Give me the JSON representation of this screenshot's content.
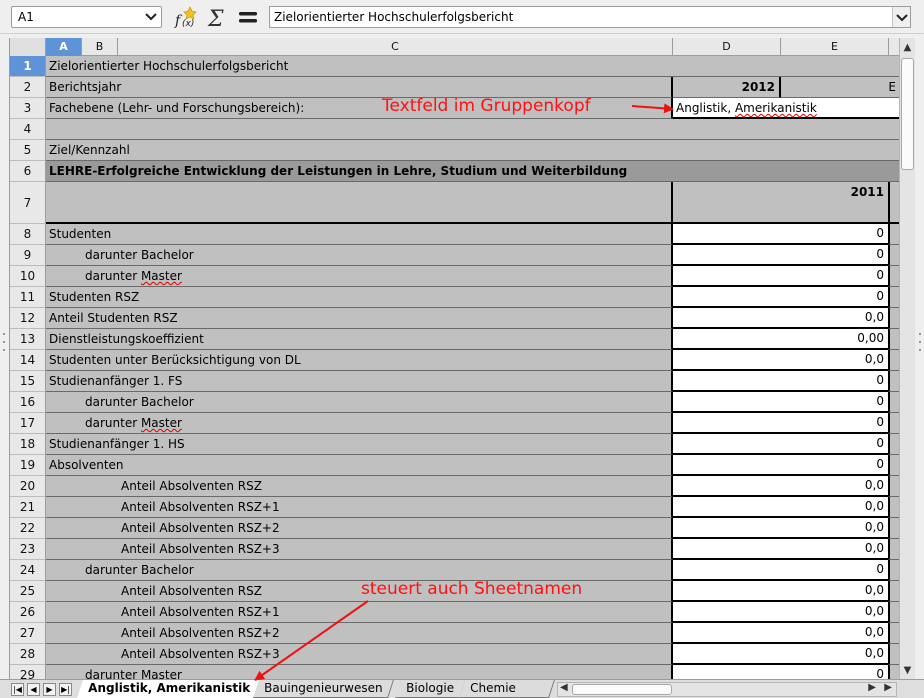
{
  "formula_bar": {
    "name_box": "A1",
    "function_wizard_icon": "function-wizard-icon",
    "sum_icon": "sum-icon",
    "equals_icon": "equals-icon",
    "formula": "Zielorientierter Hochschulerfolgsbericht"
  },
  "columns": [
    {
      "label": "A",
      "selected": true
    },
    {
      "label": "B",
      "selected": false
    },
    {
      "label": "C",
      "selected": false
    },
    {
      "label": "D",
      "selected": false
    },
    {
      "label": "E",
      "selected": false
    }
  ],
  "header": {
    "r1": "Zielorientierter Hochschulerfolgsbericht",
    "r2_label": "Berichtsjahr",
    "r2_value": "2012",
    "r2_e": "E",
    "r3_label": "Fachebene (Lehr- und Forschungsbereich):",
    "r3_value_a": "Anglistik, ",
    "r3_value_b": "Amerikanistik",
    "r5": "Ziel/Kennzahl",
    "r6": "LEHRE-Erfolgreiche Entwicklung der Leistungen in Lehre, Studium und Weiterbildung",
    "r7_value": "2011"
  },
  "row_numbers": [
    "1",
    "2",
    "3",
    "4",
    "5",
    "6",
    "7",
    "8",
    "9",
    "10",
    "11",
    "12",
    "13",
    "14",
    "15",
    "16",
    "17",
    "18",
    "19",
    "20",
    "21",
    "22",
    "23",
    "24",
    "25",
    "26",
    "27",
    "28",
    "29"
  ],
  "data_rows": [
    {
      "label": "Studenten",
      "value": "0"
    },
    {
      "label": "darunter Bachelor",
      "value": "0"
    },
    {
      "label": "darunter ",
      "label_b": "Master",
      "value": "0"
    },
    {
      "label": "Studenten RSZ",
      "value": "0"
    },
    {
      "label": "Anteil Studenten RSZ",
      "value": "0,0"
    },
    {
      "label": "Dienstleistungskoeffizient",
      "value": "0,00"
    },
    {
      "label": "Studenten unter Berücksichtigung von DL",
      "value": "0,0"
    },
    {
      "label": "Studienanfänger 1. FS",
      "value": "0"
    },
    {
      "label": "darunter Bachelor",
      "value": "0"
    },
    {
      "label": "darunter ",
      "label_b": "Master",
      "value": "0"
    },
    {
      "label": "Studienanfänger 1. HS",
      "value": "0"
    },
    {
      "label": "Absolventen",
      "value": "0"
    },
    {
      "label": "Anteil Absolventen RSZ",
      "value": "0,0"
    },
    {
      "label": "Anteil Absolventen RSZ+1",
      "value": "0,0"
    },
    {
      "label": "Anteil Absolventen RSZ+2",
      "value": "0,0"
    },
    {
      "label": "Anteil Absolventen RSZ+3",
      "value": "0,0"
    },
    {
      "label": "darunter Bachelor",
      "value": "0"
    },
    {
      "label": "Anteil Absolventen RSZ",
      "value": "0,0"
    },
    {
      "label": "Anteil Absolventen RSZ+1",
      "value": "0,0"
    },
    {
      "label": "Anteil Absolventen RSZ+2",
      "value": "0,0"
    },
    {
      "label": "Anteil Absolventen RSZ+3",
      "value": "0,0"
    },
    {
      "label": "darunter Master",
      "value": "0"
    }
  ],
  "sheet_tabs": [
    "Anglistik, Amerikanistik",
    "Bauingenieurwesen",
    "Biologie",
    "Chemie"
  ],
  "annotations": {
    "textfeld": "Textfeld im Gruppenkopf",
    "sheetnamen": "steuert auch Sheetnamen",
    "color": "#ff1111"
  },
  "colors": {
    "selection": "#5e93d8",
    "label_cell": "#c0c0c0",
    "section_cell": "#9a9a9a"
  }
}
